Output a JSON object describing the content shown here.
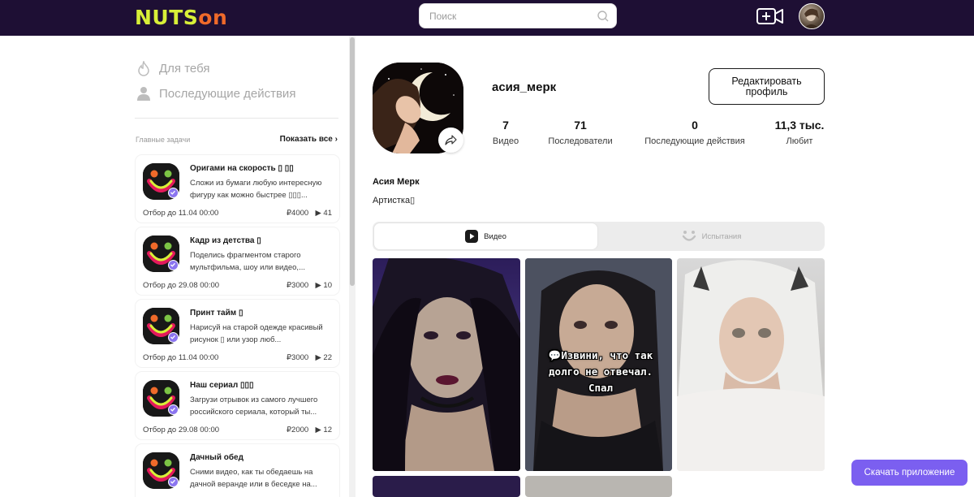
{
  "header": {
    "logo_part1": "NUTS",
    "logo_part2": "on",
    "search_placeholder": "Поиск"
  },
  "sidebar": {
    "nav": [
      {
        "label": "Для тебя",
        "icon": "flame-icon"
      },
      {
        "label": "Последующие действия",
        "icon": "person-icon"
      }
    ],
    "tasks_title": "Главные задачи",
    "show_all": "Показать все",
    "tasks": [
      {
        "title": "Оригами на скорость ▯ ▯▯",
        "desc": "Сложи из бумаги любую интересную фигуру как можно быстрее ▯▯▯...",
        "deadline": "Отбор до 11.04 00:00",
        "prize": "₽4000",
        "views": "41"
      },
      {
        "title": "Кадр из детства ▯",
        "desc": "Поделись фрагментом старого мультфильма, шоу или видео,...",
        "deadline": "Отбор до 29.08 00:00",
        "prize": "₽3000",
        "views": "10"
      },
      {
        "title": "Принт тайм ▯",
        "desc": "Нарисуй на старой одежде красивый рисунок ▯ или узор люб...",
        "deadline": "Отбор до 11.04 00:00",
        "prize": "₽3000",
        "views": "22"
      },
      {
        "title": "Наш сериал ▯▯▯",
        "desc": "Загрузи отрывок из самого лучшего российского сериала, который ты...",
        "deadline": "Отбор до 29.08 00:00",
        "prize": "₽2000",
        "views": "12"
      },
      {
        "title": "Дачный обед",
        "desc": "Сними видео, как ты обедаешь на дачной веранде или в беседке на...",
        "deadline": "",
        "prize": "",
        "views": ""
      }
    ]
  },
  "profile": {
    "username": "асия_мерк",
    "edit_label": "Редактировать профиль",
    "stats": [
      {
        "value": "7",
        "label": "Видео"
      },
      {
        "value": "71",
        "label": "Последователи"
      },
      {
        "value": "0",
        "label": "Последующие действия"
      },
      {
        "value": "11,3 тыс.",
        "label": "Любит"
      }
    ],
    "real_name": "Асия Мерк",
    "bio": "Артистка▯"
  },
  "tabs": [
    {
      "label": "Видео",
      "active": true
    },
    {
      "label": "Испытания",
      "active": false
    }
  ],
  "videos": {
    "caption": "💬Извини, что так долго не отвечал. Спал"
  },
  "download_label": "Скачать приложение",
  "colors": {
    "header_bg": "#1e0f34",
    "logo_yellow": "#d8ef38",
    "logo_orange": "#f06a2a",
    "accent_purple": "#7b5ff0"
  }
}
